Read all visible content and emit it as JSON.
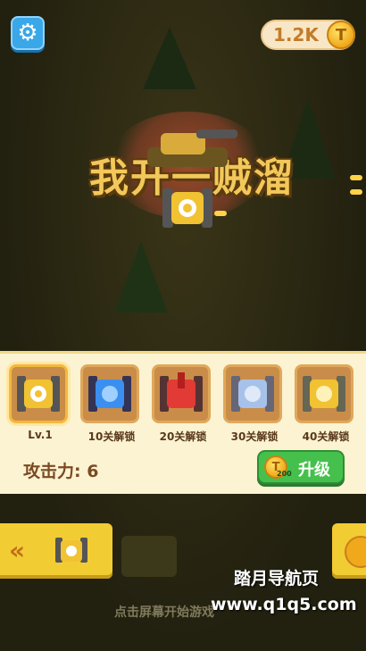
{
  "header": {
    "settings_icon": "gear-icon",
    "coins": "1.2K",
    "coin_symbol": "T"
  },
  "title": {
    "text": "我开一贼溜"
  },
  "tank_select": {
    "slots": [
      {
        "label": "Lv.1",
        "color": "#f1c232",
        "selected": true
      },
      {
        "label": "10关解锁",
        "color": "#3b8ff0",
        "selected": false
      },
      {
        "label": "20关解锁",
        "color": "#e23a35",
        "selected": false
      },
      {
        "label": "30关解锁",
        "color": "#a7c2ea",
        "selected": false
      },
      {
        "label": "40关解锁",
        "color": "#f1c232",
        "selected": false
      }
    ],
    "attack_label": "攻击力: 6",
    "upgrade": {
      "label": "升级",
      "cost": "200",
      "coin_symbol": "T"
    }
  },
  "bottom": {
    "back_chevron": "«",
    "start_hint": "点击屏幕开始游戏"
  },
  "watermark": {
    "line1": "踏月导航页",
    "line2": "www.q1q5.com"
  },
  "colors": {
    "accent_yellow": "#f2cc33",
    "upgrade_green": "#46c04c",
    "settings_blue": "#3aa7e8"
  }
}
